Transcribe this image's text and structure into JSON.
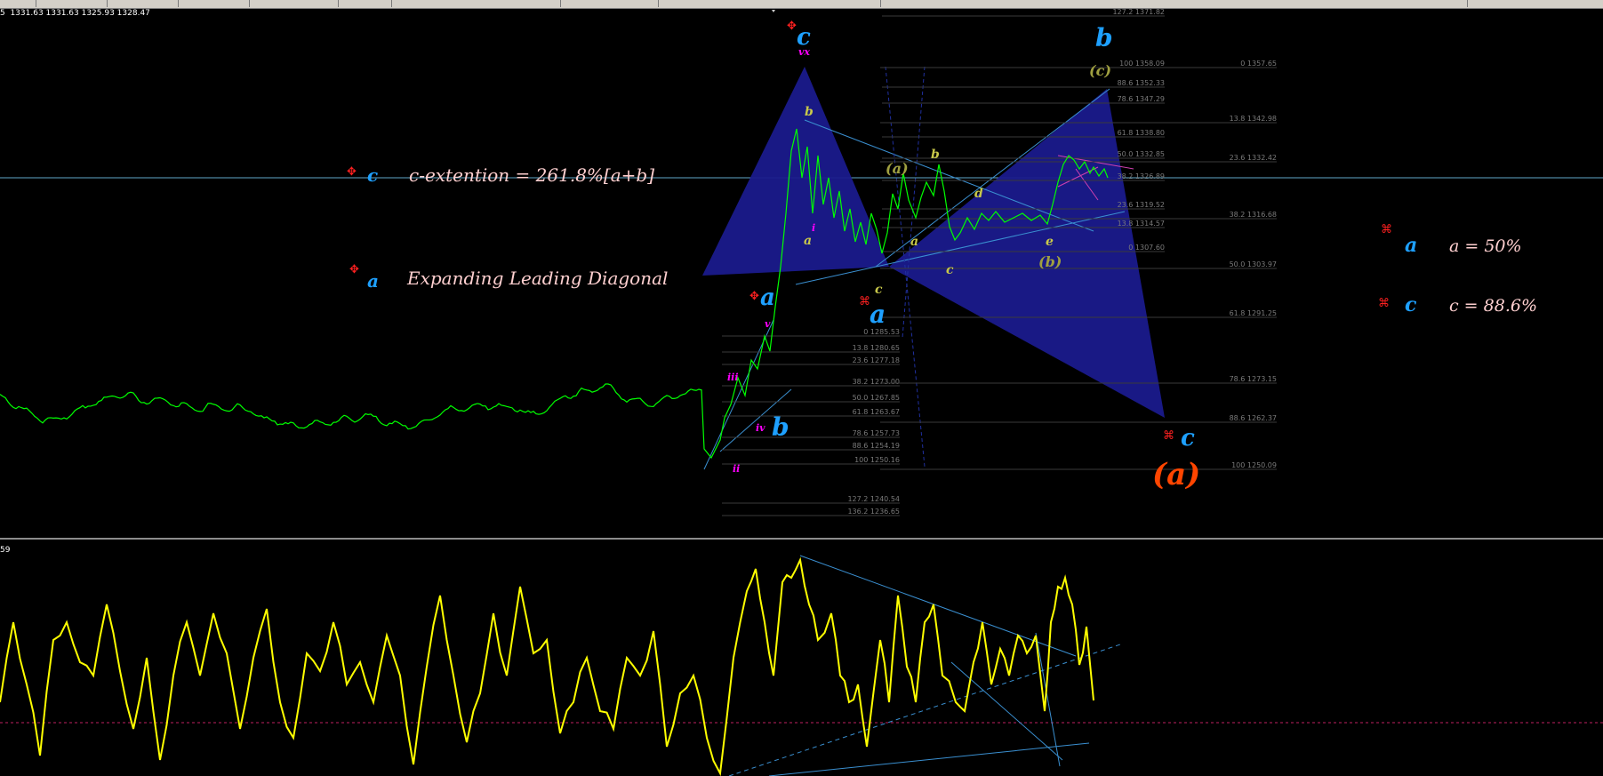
{
  "ohlc_line": "5  1331.63 1331.63 1325.93 1328.47",
  "indicator_title": "59",
  "annotations": {
    "c_extension_tag": "c",
    "c_extension_text": "c-extention = 261.8%[a+b]",
    "leading_diagonal_tag": "a",
    "leading_diagonal_text": "Expanding Leading Diagonal",
    "right_a_tag": "a",
    "right_a_text": "a = 50%",
    "right_c_tag": "c",
    "right_c_text": "c = 88.6%"
  },
  "wave_labels": {
    "c_top": "c",
    "b_top": "b",
    "a_mid": "a",
    "b_low": "b",
    "a_low": "a",
    "c_bottom": "c",
    "big_a": "(a)",
    "paren_a": "(a)",
    "paren_b": "(b)",
    "paren_c": "(c)",
    "sub_b": "b",
    "sub_a": "a",
    "sub_c": "c",
    "sub_d": "d",
    "sub_e": "e",
    "sub_b_left": "b",
    "sub_a_left": "a",
    "sub_c_left": "c",
    "roman_v": "v",
    "roman_iv": "iv",
    "roman_iii": "iii",
    "roman_ii": "ii",
    "roman_i": "i",
    "roman_vx": "vx"
  },
  "fib_left": [
    "0 1285.53",
    "13.8 1280.65",
    "23.6 1277.18",
    "38.2 1273.00",
    "50.0 1267.85",
    "61.8 1263.67",
    "78.6 1257.73",
    "88.6 1254.19",
    "100 1250.16",
    "127.2 1240.54",
    "136.2 1236.65"
  ],
  "fib_mid": [
    "127.2 1371.82",
    "100 1358.09",
    "88.6 1352.33",
    "78.6 1347.29",
    "61.8 1338.80",
    "50.0 1332.85",
    "38.2 1326.89",
    "23.6 1319.52",
    "13.8 1314.57",
    "0 1307.60"
  ],
  "fib_right": [
    "0 1357.65",
    "13.8 1342.98",
    "23.6 1332.42",
    "38.2 1316.68",
    "50.0 1303.97",
    "61.8 1291.25",
    "78.6 1273.15",
    "88.6 1262.37",
    "100 1250.09"
  ],
  "colors": {
    "background": "#000000",
    "price_line": "#00ff00",
    "oscillator": "#ffff00",
    "triangle_fill": "#1a1a8c",
    "wave_blue": "#1e90ff",
    "roman_magenta": "#ff00ff",
    "sub_yellow": "#c8c84a",
    "accent_orange": "#ff4500",
    "marker_red": "#ff0000"
  }
}
